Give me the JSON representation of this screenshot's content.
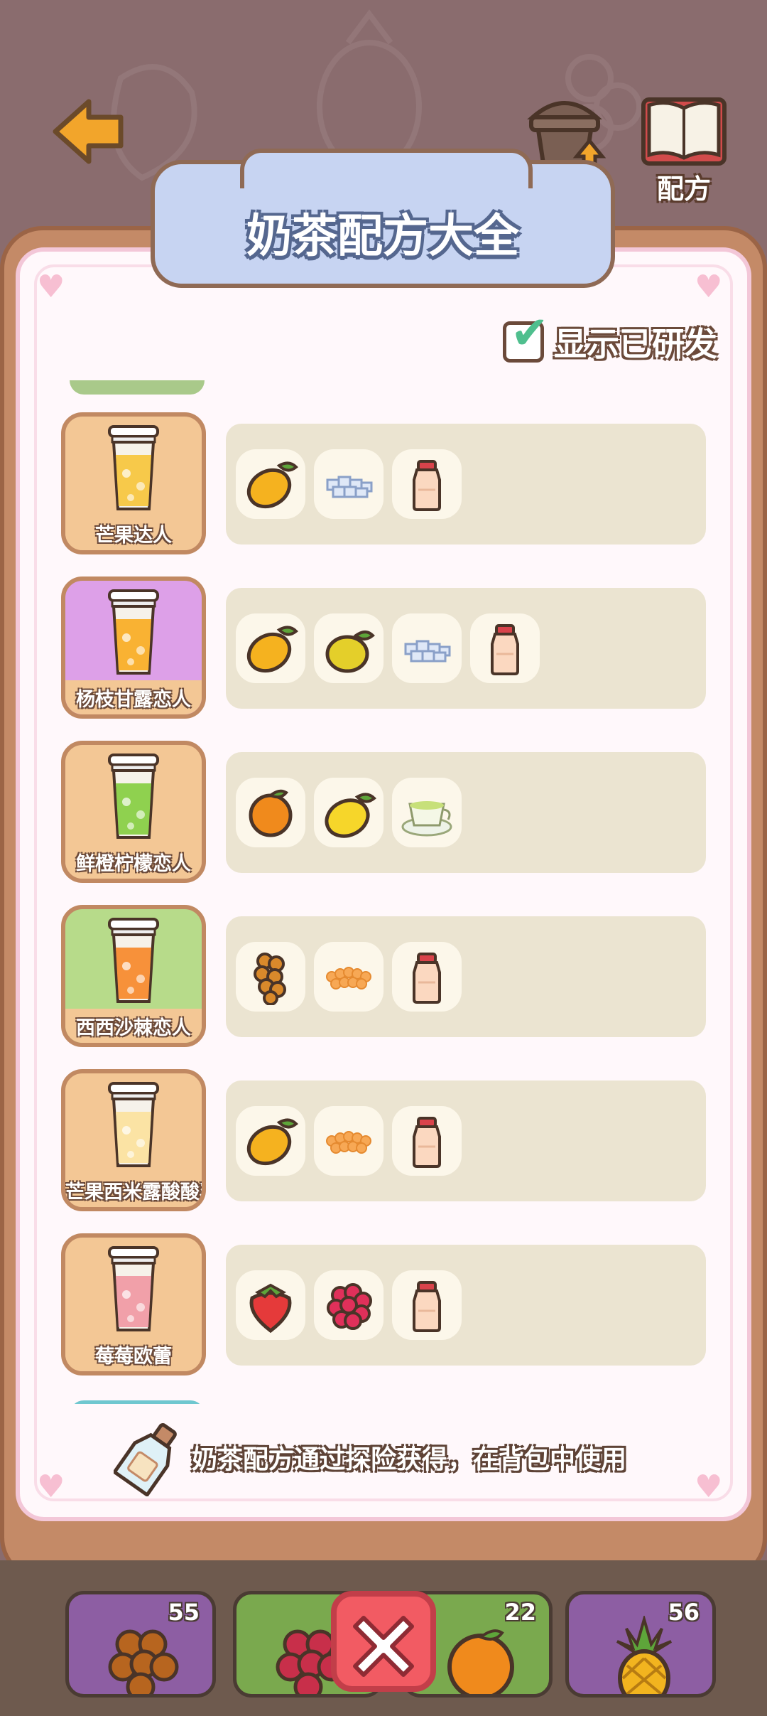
{
  "header": {
    "title": "奶茶配方大全",
    "back_icon": "back-arrow-icon"
  },
  "top_buttons": [
    {
      "label": "升级",
      "icon": "cup-upgrade-icon"
    },
    {
      "label": "配方",
      "icon": "recipe-book-icon"
    }
  ],
  "toggle": {
    "label": "显示已研发",
    "checked": true
  },
  "recipes": [
    {
      "name": "芒果达人",
      "card_color": "#f3c795",
      "cup_color": "#f7c94a",
      "ingredients": [
        "mango-icon",
        "sugar-cubes-icon",
        "yogurt-bottle-icon"
      ]
    },
    {
      "name": "杨枝甘露恋人",
      "card_color": "#dda0e8",
      "cup_color": "#f9b233",
      "ingredients": [
        "mango-icon",
        "pear-icon",
        "sugar-cubes-icon",
        "yogurt-bottle-icon"
      ]
    },
    {
      "name": "鲜橙柠檬恋人",
      "card_color": "#f3c795",
      "cup_color": "#8fd14f",
      "ingredients": [
        "orange-icon",
        "lemon-icon",
        "green-tea-icon"
      ]
    },
    {
      "name": "西西沙棘恋人",
      "card_color": "#b7db8a",
      "cup_color": "#f7913a",
      "ingredients": [
        "sea-buckthorn-icon",
        "tapioca-pearls-icon",
        "yogurt-bottle-icon"
      ]
    },
    {
      "name": "芒果西米露酸酸乳",
      "card_color": "#f3c795",
      "cup_color": "#fbe3a4",
      "ingredients": [
        "mango-icon",
        "tapioca-pearls-icon",
        "yogurt-bottle-icon"
      ]
    },
    {
      "name": "莓莓欧蕾",
      "card_color": "#f3c795",
      "cup_color": "#f1a0a9",
      "ingredients": [
        "strawberry-icon",
        "raspberry-icon",
        "yogurt-bottle-icon"
      ]
    }
  ],
  "hint": {
    "text": "奶茶配方通过探险获得，在背包中使用",
    "icon": "message-bottle-icon"
  },
  "inventory": [
    {
      "icon": "sea-buckthorn-icon",
      "count": "55"
    },
    {
      "icon": "raspberry-icon",
      "count": ""
    },
    {
      "icon": "orange-icon",
      "count": "22"
    },
    {
      "icon": "pineapple-icon",
      "count": "56"
    }
  ],
  "close_icon": "close-x-icon"
}
